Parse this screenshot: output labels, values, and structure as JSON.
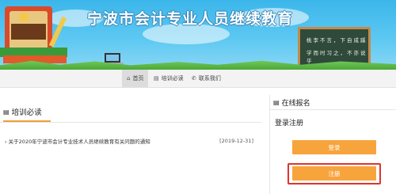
{
  "banner": {
    "title": "宁波市会计专业人员继续教育",
    "chalkboard_lines": [
      "桃李不言，下自成蹊",
      "学而时习之，不亦说乎"
    ]
  },
  "nav": {
    "items": [
      {
        "label": "首页",
        "icon": "home-icon",
        "active": true
      },
      {
        "label": "培训必读",
        "icon": "book-icon",
        "active": false
      },
      {
        "label": "联系我们",
        "icon": "phone-icon",
        "active": false
      }
    ]
  },
  "training": {
    "title": "培训必读",
    "items": [
      {
        "title": "关于2020年宁波市会计专业技术人员继续教育有关问题的通知",
        "date": "[2019-12-31]"
      }
    ]
  },
  "signup": {
    "title": "在线报名",
    "subtitle": "登录注册",
    "login_label": "登录",
    "register_label": "注册"
  },
  "colors": {
    "accent": "#f7a43d",
    "highlight": "#e0342c",
    "banner": "#3bb6ea"
  }
}
